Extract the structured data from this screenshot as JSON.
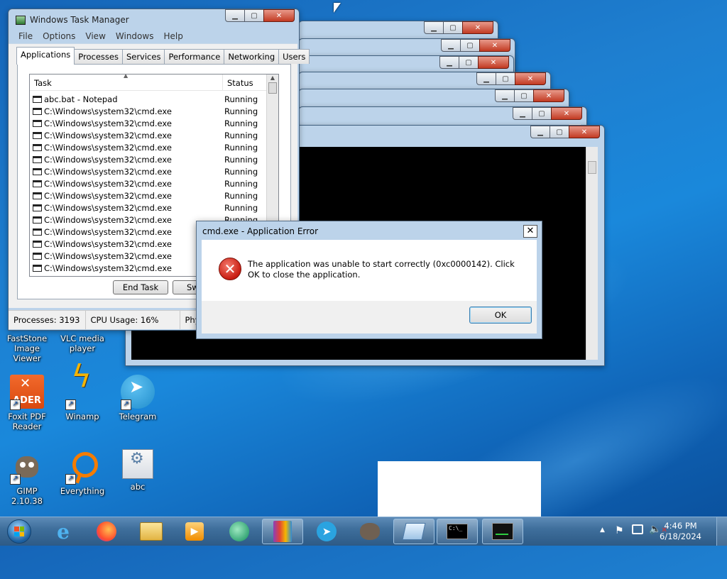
{
  "task_manager": {
    "title": "Windows Task Manager",
    "menu": [
      "File",
      "Options",
      "View",
      "Windows",
      "Help"
    ],
    "tabs": [
      "Applications",
      "Processes",
      "Services",
      "Performance",
      "Networking",
      "Users"
    ],
    "columns": {
      "task": "Task",
      "status": "Status"
    },
    "rows": [
      {
        "task": "abc.bat - Notepad",
        "status": "Running"
      },
      {
        "task": "C:\\Windows\\system32\\cmd.exe",
        "status": "Running"
      },
      {
        "task": "C:\\Windows\\system32\\cmd.exe",
        "status": "Running"
      },
      {
        "task": "C:\\Windows\\system32\\cmd.exe",
        "status": "Running"
      },
      {
        "task": "C:\\Windows\\system32\\cmd.exe",
        "status": "Running"
      },
      {
        "task": "C:\\Windows\\system32\\cmd.exe",
        "status": "Running"
      },
      {
        "task": "C:\\Windows\\system32\\cmd.exe",
        "status": "Running"
      },
      {
        "task": "C:\\Windows\\system32\\cmd.exe",
        "status": "Running"
      },
      {
        "task": "C:\\Windows\\system32\\cmd.exe",
        "status": "Running"
      },
      {
        "task": "C:\\Windows\\system32\\cmd.exe",
        "status": "Running"
      },
      {
        "task": "C:\\Windows\\system32\\cmd.exe",
        "status": "Running"
      },
      {
        "task": "C:\\Windows\\system32\\cmd.exe",
        "status": ""
      },
      {
        "task": "C:\\Windows\\system32\\cmd.exe",
        "status": ""
      },
      {
        "task": "C:\\Windows\\system32\\cmd.exe",
        "status": ""
      },
      {
        "task": "C:\\Windows\\system32\\cmd.exe",
        "status": ""
      }
    ],
    "buttons": {
      "end_task": "End Task",
      "switch_to": "Switch"
    },
    "status": {
      "processes": "Processes: 3193",
      "cpu": "CPU Usage: 16%",
      "phys": "Phy"
    }
  },
  "dialog": {
    "title": "cmd.exe - Application Error",
    "message": "The application was unable to start correctly (0xc0000142). Click OK to close the application.",
    "ok": "OK",
    "icon": "error-icon"
  },
  "desktop_icons": [
    {
      "id": "faststone",
      "label": "FastStone Image Viewer"
    },
    {
      "id": "vlc",
      "label": "VLC media player"
    },
    {
      "id": "foxit",
      "label": "Foxit PDF Reader",
      "badge": "ADER"
    },
    {
      "id": "winamp",
      "label": "Winamp"
    },
    {
      "id": "telegram",
      "label": "Telegram"
    },
    {
      "id": "gimp",
      "label": "GIMP 2.10.38"
    },
    {
      "id": "everything",
      "label": "Everything"
    },
    {
      "id": "abc",
      "label": "abc"
    }
  ],
  "taskbar": {
    "items": [
      "start-orb",
      "internet-explorer",
      "firefox",
      "file-explorer",
      "media-player",
      "green-app",
      "winrar",
      "telegram",
      "gimp",
      "notepad",
      "cmd",
      "task-manager"
    ],
    "clock_time": "4:46 PM",
    "clock_date": "6/18/2024"
  },
  "cmd_icon_text": "C:\\_",
  "colors": {
    "accent": "#1e7fd0",
    "error": "#c81d12"
  }
}
